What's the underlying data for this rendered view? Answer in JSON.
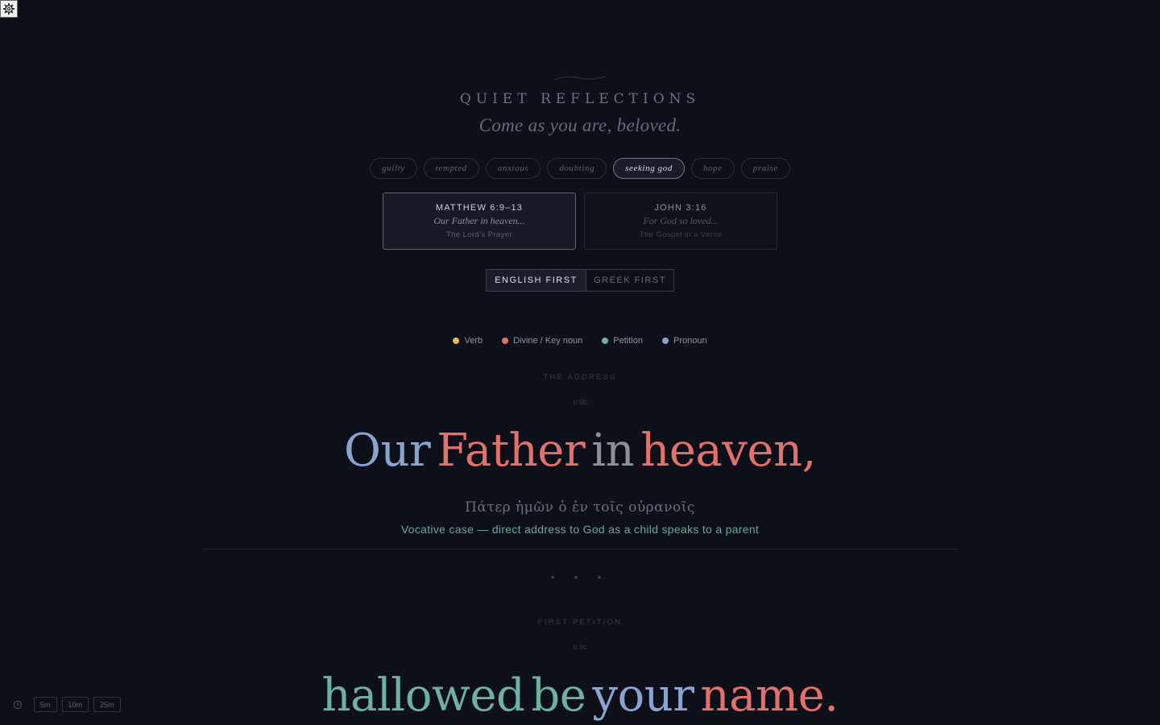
{
  "header": {
    "title": "QUIET REFLECTIONS",
    "subtitle": "Come as you are, beloved."
  },
  "moods": [
    {
      "label": "guilty",
      "active": false
    },
    {
      "label": "tempted",
      "active": false
    },
    {
      "label": "anxious",
      "active": false
    },
    {
      "label": "doubting",
      "active": false
    },
    {
      "label": "seeking god",
      "active": true
    },
    {
      "label": "hope",
      "active": false
    },
    {
      "label": "praise",
      "active": false
    }
  ],
  "passages": [
    {
      "ref": "MATTHEW 6:9–13",
      "line": "Our Father in heaven...",
      "name": "The Lord's Prayer",
      "active": true
    },
    {
      "ref": "JOHN 3:16",
      "line": "For God so loved...",
      "name": "The Gospel in a Verse",
      "active": false
    }
  ],
  "order_toggle": {
    "english_first": "ENGLISH FIRST",
    "greek_first": "GREEK FIRST",
    "selected": "english_first"
  },
  "legend": [
    {
      "label": "Verb",
      "color": "#e6b85c"
    },
    {
      "label": "Divine / Key noun",
      "color": "#e0716b"
    },
    {
      "label": "Petition",
      "color": "#6fb09e"
    },
    {
      "label": "Pronoun",
      "color": "#8ba3cf"
    }
  ],
  "colors": {
    "pronoun": "#8ba3cf",
    "divine": "#e0716b",
    "petition": "#6fb09e",
    "neutral": "#8c909a"
  },
  "sections": [
    {
      "label": "THE ADDRESS",
      "ref": "6:9b",
      "words": [
        {
          "text": "Our",
          "kind": "pronoun"
        },
        {
          "text": "Father",
          "kind": "divine"
        },
        {
          "text": "in",
          "kind": "neutral"
        },
        {
          "text": "heaven,",
          "kind": "divine"
        }
      ],
      "greek": "Πάτερ ἡμῶν ὁ ἐν τοῖς οὐρανοῖς",
      "gloss": "Vocative case — direct address to God as a child speaks to a parent"
    },
    {
      "label": "FIRST PETITION",
      "ref": "6:9c",
      "words": [
        {
          "text": "hallowed",
          "kind": "petition"
        },
        {
          "text": "be",
          "kind": "petition"
        },
        {
          "text": "your",
          "kind": "pronoun"
        },
        {
          "text": "name.",
          "kind": "divine"
        }
      ]
    }
  ],
  "separator": "• • •",
  "timer": {
    "options": [
      "5m",
      "10m",
      "25m"
    ]
  }
}
